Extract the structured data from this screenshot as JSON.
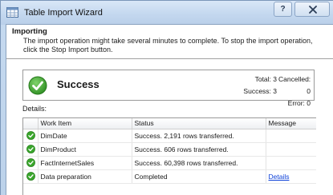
{
  "window": {
    "title": "Table Import Wizard"
  },
  "titlebar": {
    "help_label": "?"
  },
  "header": {
    "title": "Importing",
    "description": "The import operation might take several minutes to complete. To stop the import operation, click the Stop Import button."
  },
  "status": {
    "text": "Success",
    "total_label": "Total: 3",
    "success_label": "Success: 3",
    "cancelled_label": "Cancelled: 0",
    "error_label": "Error: 0"
  },
  "details": {
    "label": "Details:",
    "columns": [
      "Work Item",
      "Status",
      "Message"
    ],
    "rows": [
      {
        "work_item": "DimDate",
        "status": "Success. 2,191 rows transferred.",
        "message": ""
      },
      {
        "work_item": "DimProduct",
        "status": "Success. 606 rows transferred.",
        "message": ""
      },
      {
        "work_item": "FactInternetSales",
        "status": "Success. 60,398 rows transferred.",
        "message": ""
      },
      {
        "work_item": "Data preparation",
        "status": "Completed",
        "message": "Details"
      }
    ]
  },
  "colors": {
    "success_green": "#3aa62c",
    "link_blue": "#0b3fd8",
    "title_bar": "#c4d8ef"
  },
  "icons": {
    "app": "table-wizard-icon",
    "success": "check-circle-icon",
    "close": "close-icon"
  }
}
